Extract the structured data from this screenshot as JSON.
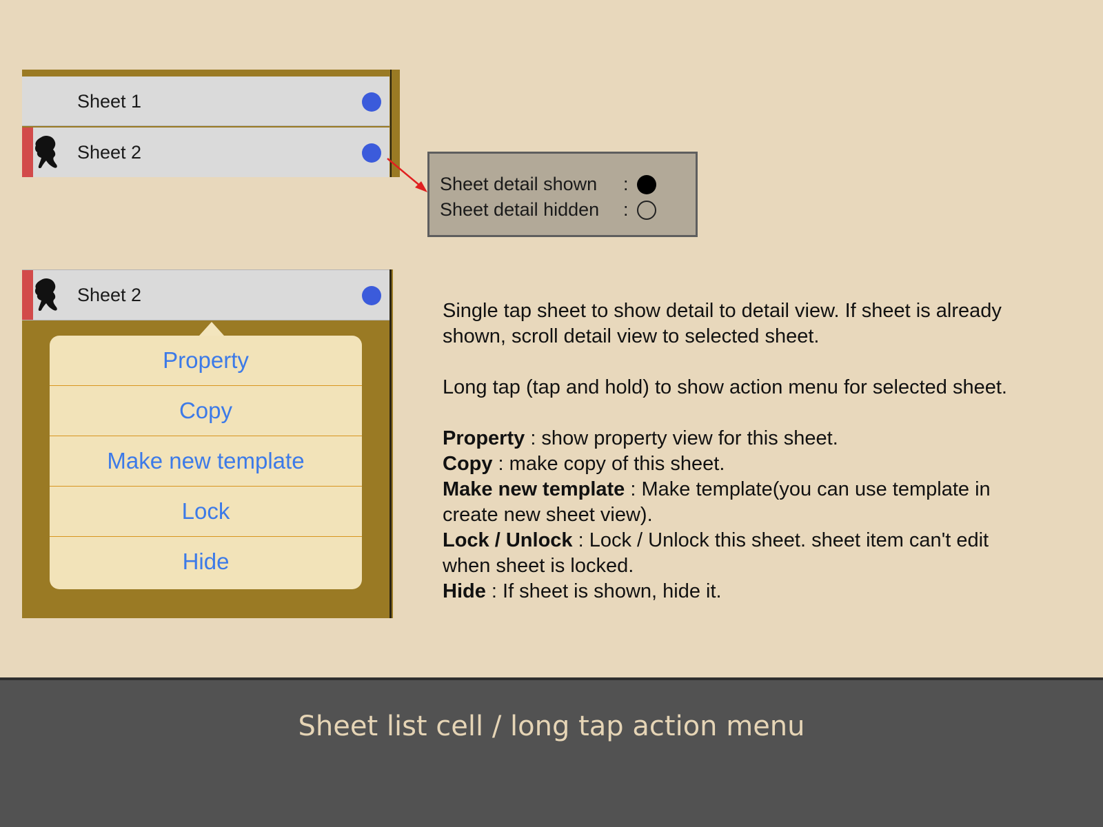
{
  "sheet_list_top": {
    "cells": [
      {
        "label": "Sheet 1",
        "has_marker": false
      },
      {
        "label": "Sheet 2",
        "has_marker": true
      }
    ]
  },
  "legend": {
    "shown_label": "Sheet detail shown",
    "hidden_label": "Sheet detail hidden",
    "separator": ":"
  },
  "sheet_list_bottom": {
    "cell_label": "Sheet 2"
  },
  "action_menu": {
    "items": [
      "Property",
      "Copy",
      "Make new template",
      "Lock",
      "Hide"
    ]
  },
  "description": {
    "tap_text": " Single tap sheet to show detail to detail view. If sheet is already shown, scroll detail view to selected sheet.",
    "long_tap_text": " Long tap (tap and hold) to show action menu for selected sheet.",
    "items": [
      {
        "term": "Property",
        "text": " : show property view for this sheet."
      },
      {
        "term": "Copy",
        "text": " : make copy of this sheet."
      },
      {
        "term": "Make new template",
        "text": " : Make template(you can use template in create new sheet view)."
      },
      {
        "term": "Lock / Unlock",
        "text": " : Lock / Unlock this sheet. sheet item can't edit when sheet is locked."
      },
      {
        "term": "Hide",
        "text": " : If sheet is shown, hide it."
      }
    ]
  },
  "footer": {
    "title": "Sheet list cell / long tap action menu"
  },
  "colors": {
    "background": "#e8d8bc",
    "list_frame": "#9a7a24",
    "cell": "#dadada",
    "detail_dot": "#3b5bdb",
    "lock_marker": "#d24a4a",
    "menu_background": "#f2e3b9",
    "menu_text": "#3c7ae8",
    "menu_divider": "#d8951e",
    "footer": "#525252",
    "footer_text": "#e6d5b6"
  },
  "icons": {
    "avatar": "silhouette-icon",
    "detail_indicator": "filled-circle-icon",
    "pointer": "red-arrow-icon"
  }
}
